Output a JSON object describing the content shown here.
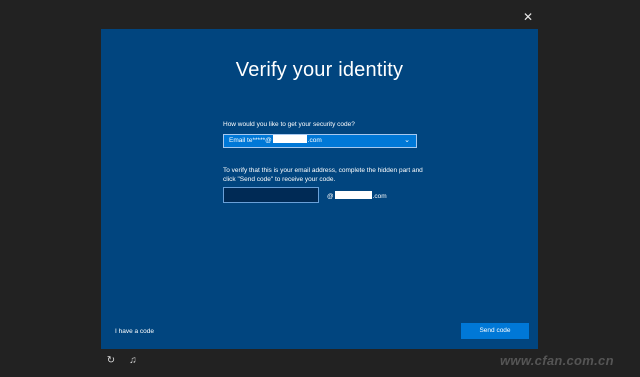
{
  "window": {
    "close_icon": "close-icon"
  },
  "dialog": {
    "title": "Verify your identity",
    "method_label": "How would you like to get your security code?",
    "method_select": {
      "prefix": "Email te*****@",
      "suffix": ".com"
    },
    "description": "To verify that this is your email address, complete the hidden part and click \"Send code\" to receive your code.",
    "email_input": {
      "value": "",
      "suffix_prefix": "@",
      "suffix_suffix": ".com"
    },
    "have_code_link": "I have a code",
    "send_button": "Send code"
  },
  "footer": {
    "icons": [
      "ease-of-access-icon",
      "accessibility-icon"
    ],
    "watermark": "www.cfan.com.cn"
  },
  "colors": {
    "background": "#222222",
    "panel": "#01457f",
    "accent": "#0078d7"
  }
}
